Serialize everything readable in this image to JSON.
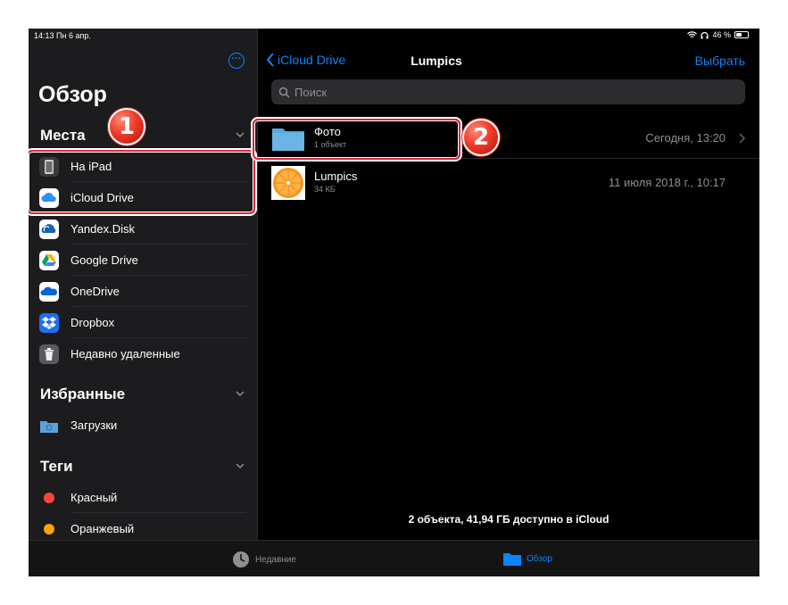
{
  "status_bar": {
    "time_date": "14:13  Пн 6 апр.",
    "battery_text": "46 %",
    "battery_level": 0.46
  },
  "sidebar": {
    "title": "Обзор",
    "sections": {
      "places": {
        "title": "Места",
        "items": [
          {
            "label": "На iPad",
            "icon": "ipad-icon"
          },
          {
            "label": "iCloud Drive",
            "icon": "icloud-icon"
          },
          {
            "label": "Yandex.Disk",
            "icon": "yandex-disk-icon"
          },
          {
            "label": "Google Drive",
            "icon": "google-drive-icon"
          },
          {
            "label": "OneDrive",
            "icon": "onedrive-icon"
          },
          {
            "label": "Dropbox",
            "icon": "dropbox-icon"
          },
          {
            "label": "Недавно удаленные",
            "icon": "trash-icon"
          }
        ]
      },
      "favorites": {
        "title": "Избранные",
        "items": [
          {
            "label": "Загрузки",
            "icon": "downloads-folder-icon"
          }
        ]
      },
      "tags": {
        "title": "Теги",
        "items": [
          {
            "label": "Красный",
            "color": "#ff453a"
          },
          {
            "label": "Оранжевый",
            "color": "#ff9f0a"
          }
        ]
      }
    }
  },
  "nav": {
    "back_label": "iCloud Drive",
    "title": "Lumpics",
    "select_label": "Выбрать"
  },
  "search": {
    "placeholder": "Поиск"
  },
  "files": [
    {
      "name": "Фото",
      "subtitle": "1 объект",
      "date": "Сегодня, 13:20",
      "icon": "folder-icon"
    },
    {
      "name": "Lumpics",
      "subtitle": "34 КБ",
      "date": "11 июля 2018 г., 10:17",
      "icon": "orange-image-icon"
    }
  ],
  "footer_info": "2 объекта, 41,94 ГБ доступно в iCloud",
  "tab_bar": {
    "recent_label": "Недавние",
    "browse_label": "Обзор"
  },
  "annotations": {
    "badge_1": "1",
    "badge_2": "2"
  },
  "colors": {
    "accent": "#0a84ff",
    "highlight": "#d8283c"
  }
}
